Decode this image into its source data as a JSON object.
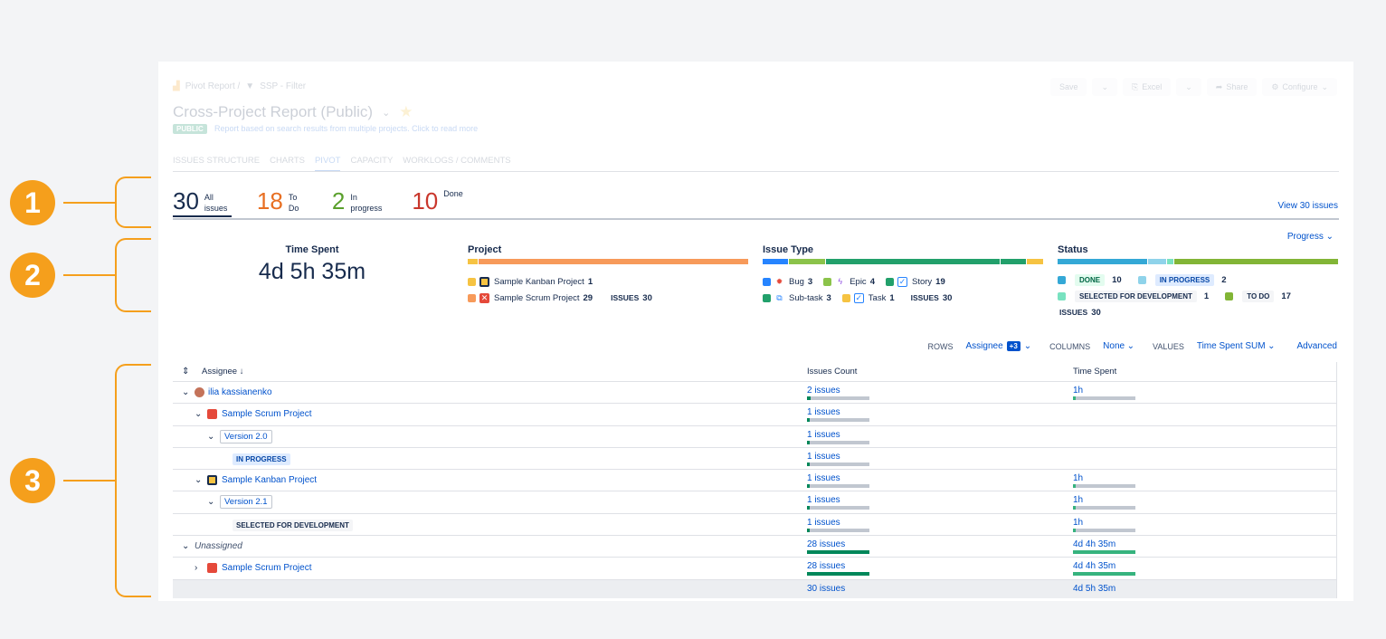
{
  "header": {
    "breadcrumb": [
      "Pivot Report /",
      "SSP - Filter"
    ],
    "title": "Cross-Project Report (Public)",
    "public_badge": "PUBLIC",
    "description": "Report based on search results from multiple projects. Click to read more",
    "buttons": {
      "save": "Save",
      "excel": "Excel",
      "share": "Share",
      "configure": "Configure"
    },
    "tabs": [
      "ISSUES STRUCTURE",
      "CHARTS",
      "PIVOT",
      "CAPACITY",
      "WORKLOGS / COMMENTS"
    ]
  },
  "counts": [
    {
      "num": "30",
      "label": "All issues",
      "color": "#172b4d"
    },
    {
      "num": "18",
      "label": "To Do",
      "color": "#e86f22"
    },
    {
      "num": "2",
      "label": "In progress",
      "color": "#5aa02c"
    },
    {
      "num": "10",
      "label": "Done",
      "color": "#c9372c"
    }
  ],
  "view_link": "View 30 issues",
  "summary": {
    "time_spent_label": "Time Spent",
    "time_spent_value": "4d 5h 35m",
    "progress_dropdown": "Progress",
    "project": {
      "title": "Project",
      "items": [
        {
          "name": "Sample Kanban Project",
          "count": "1",
          "color": "#f6c342"
        },
        {
          "name": "Sample Scrum Project",
          "count": "29",
          "color": "#f79a5a"
        }
      ],
      "issues_label": "ISSUES",
      "issues_total": "30"
    },
    "issue_type": {
      "title": "Issue Type",
      "items": [
        {
          "name": "Bug",
          "count": "3",
          "color": "#2684ff"
        },
        {
          "name": "Epic",
          "count": "4",
          "color": "#8bc34a"
        },
        {
          "name": "Story",
          "count": "19",
          "color": "#22a06b"
        },
        {
          "name": "Sub-task",
          "count": "3",
          "color": "#22a06b"
        },
        {
          "name": "Task",
          "count": "1",
          "color": "#f6c342"
        }
      ],
      "issues_label": "ISSUES",
      "issues_total": "30"
    },
    "status": {
      "title": "Status",
      "items": [
        {
          "name": "DONE",
          "count": "10",
          "color": "#34a8d6"
        },
        {
          "name": "IN PROGRESS",
          "count": "2",
          "color": "#8fd3ea"
        },
        {
          "name": "SELECTED FOR DEVELOPMENT",
          "count": "1",
          "color": "#79e2c0"
        },
        {
          "name": "TO DO",
          "count": "17",
          "color": "#82b536"
        }
      ],
      "issues_label": "ISSUES",
      "issues_total": "30"
    }
  },
  "controls": {
    "rows_label": "ROWS",
    "rows_value": "Assignee",
    "rows_extra": "+3",
    "columns_label": "COLUMNS",
    "columns_value": "None",
    "values_label": "VALUES",
    "values_value": "Time Spent SUM",
    "advanced": "Advanced"
  },
  "table": {
    "headers": {
      "assignee": "Assignee",
      "issues_count": "Issues Count",
      "time_spent": "Time Spent"
    },
    "rows": [
      {
        "label": "ilia kassianenko",
        "issues": "2 issues",
        "fill": 0.07,
        "time": "1h",
        "tfill": 0.06
      },
      {
        "label": "Sample Scrum Project",
        "issues": "1 issues",
        "fill": 0.04,
        "time": "",
        "tfill": 0
      },
      {
        "label": "Version 2.0",
        "issues": "1 issues",
        "fill": 0.04,
        "time": "",
        "tfill": 0
      },
      {
        "label": "IN PROGRESS",
        "issues": "1 issues",
        "fill": 0.04,
        "time": "",
        "tfill": 0
      },
      {
        "label": "Sample Kanban Project",
        "issues": "1 issues",
        "fill": 0.04,
        "time": "1h",
        "tfill": 0.06
      },
      {
        "label": "Version 2.1",
        "issues": "1 issues",
        "fill": 0.04,
        "time": "1h",
        "tfill": 0.06
      },
      {
        "label": "SELECTED FOR DEVELOPMENT",
        "issues": "1 issues",
        "fill": 0.04,
        "time": "1h",
        "tfill": 0.06
      },
      {
        "label": "Unassigned",
        "issues": "28 issues",
        "fill": 1.0,
        "time": "4d 4h 35m",
        "tfill": 1.0
      },
      {
        "label": "Sample Scrum Project",
        "issues": "28 issues",
        "fill": 1.0,
        "time": "4d 4h 35m",
        "tfill": 1.0
      }
    ],
    "total": {
      "issues": "30 issues",
      "time": "4d 5h 35m"
    }
  },
  "callouts": [
    "1",
    "2",
    "3"
  ]
}
